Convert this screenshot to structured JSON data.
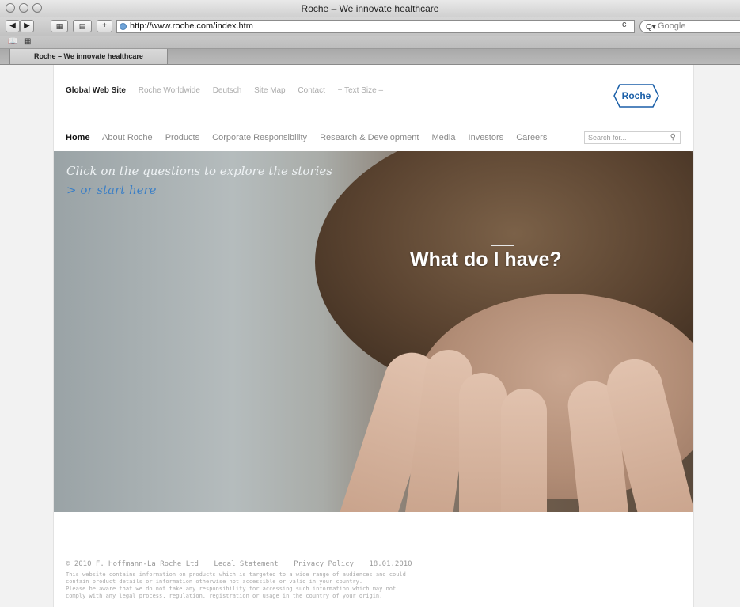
{
  "window": {
    "title": "Roche – We innovate healthcare"
  },
  "toolbar": {
    "back_icon": "◀",
    "forward_icon": "▶",
    "plus_icon": "+",
    "url": "http://www.roche.com/index.htm",
    "reload_icon": "ċ",
    "search_placeholder": "Google"
  },
  "tab": {
    "label": "Roche – We innovate healthcare"
  },
  "site": {
    "utility_nav": [
      "Global Web Site",
      "Roche Worldwide",
      "Deutsch",
      "Site Map",
      "Contact",
      "+ Text Size –"
    ],
    "logo_text": "Roche",
    "main_nav": [
      "Home",
      "About Roche",
      "Products",
      "Corporate Responsibility",
      "Research & Development",
      "Media",
      "Investors",
      "Careers"
    ],
    "search_placeholder": "Search for..."
  },
  "hero": {
    "tagline": "Click on the questions to explore the stories",
    "start_link": "> or start here",
    "question": "What do I have?"
  },
  "footer": {
    "copyright": "© 2010 F. Hoffmann-La Roche Ltd",
    "legal": "Legal Statement",
    "privacy": "Privacy Policy",
    "date": "18.01.2010",
    "note_lines": [
      "This website contains information on products which is targeted to a wide range of audiences and could",
      "contain product details or information otherwise not accessible or valid in your country.",
      "Please be aware that we do not take any responsibility for accessing such information which may not",
      "comply with any legal process, regulation, registration or usage in the country of your origin."
    ]
  },
  "colors": {
    "link_blue": "#3b7fc6",
    "logo_blue": "#1a5fa8"
  }
}
